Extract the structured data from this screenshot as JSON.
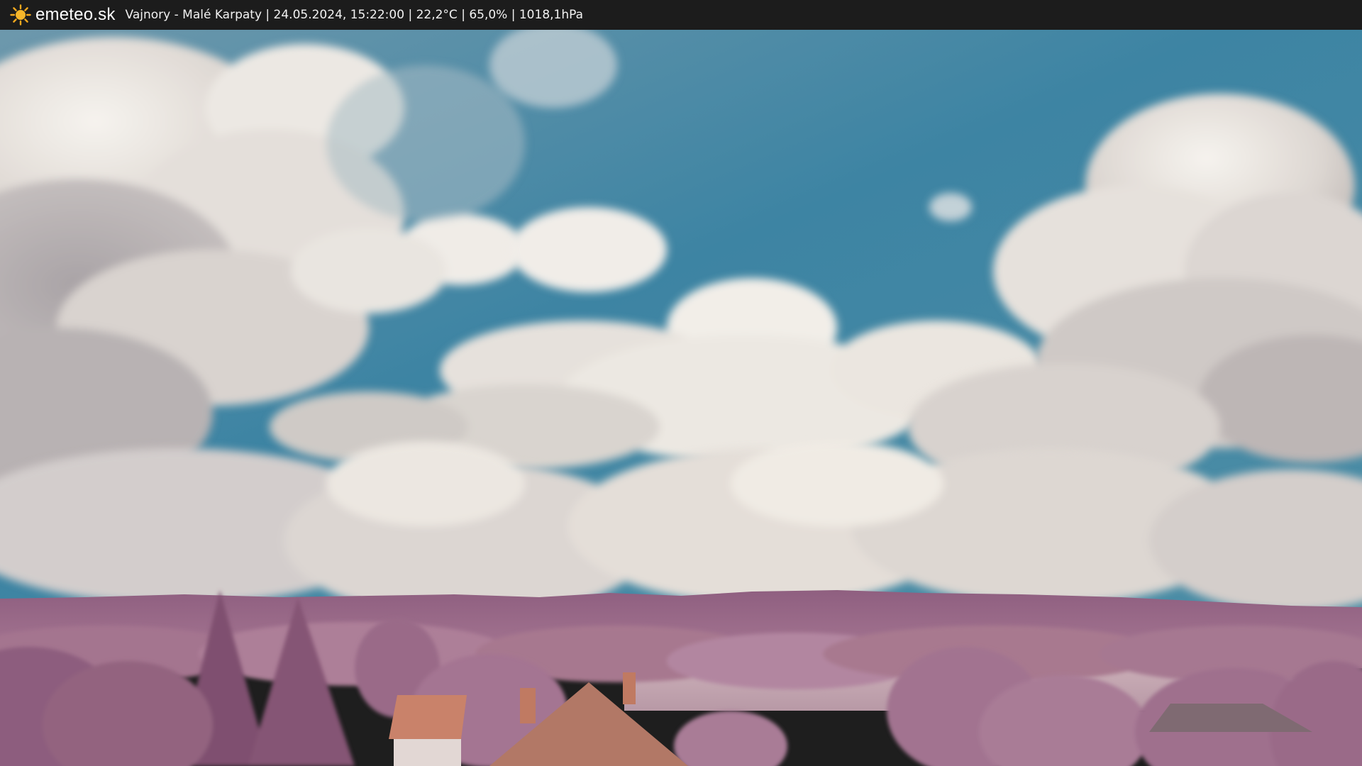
{
  "header": {
    "logo_icon": "sun-icon",
    "logo_text": "emeteo.sk",
    "caption": "Vajnory - Malé Karpaty | 24.05.2024, 15:22:00 | 22,2°C | 65,0% | 1018,1hPa"
  },
  "colors": {
    "bar_background": "#1c1c1c",
    "sun": "#f2a81d",
    "sky": "#3f8aa8",
    "foliage": "#9a6b8c"
  }
}
